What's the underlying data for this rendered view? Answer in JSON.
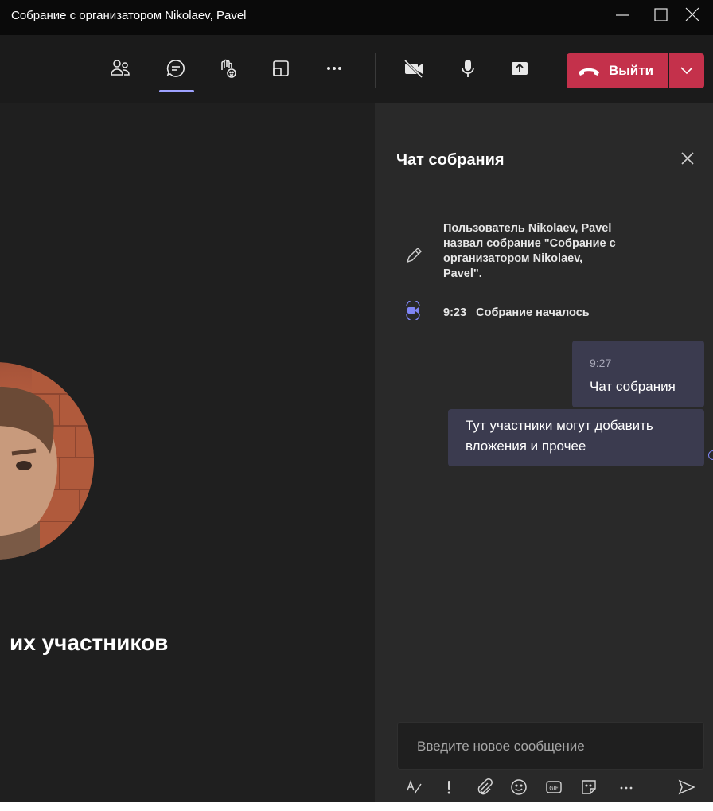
{
  "window": {
    "title": "Собрание с организатором Nikolaev, Pavel"
  },
  "toolbar": {
    "items": [
      {
        "name": "people-icon",
        "active": false
      },
      {
        "name": "chat-icon",
        "active": true
      },
      {
        "name": "reactions-icon",
        "active": false
      },
      {
        "name": "rooms-icon",
        "active": false
      },
      {
        "name": "more-icon",
        "active": false
      }
    ],
    "controls": [
      "camera-off-icon",
      "mic-icon",
      "share-icon"
    ],
    "leave_label": "Выйти",
    "accent_color": "#c4314b",
    "active_indicator_color": "#9ea2ff"
  },
  "stage": {
    "participants_text": "их участников"
  },
  "chat": {
    "title": "Чат собрания",
    "events": [
      {
        "icon": "pencil-icon",
        "lines": [
          "Пользователь Nikolaev, Pavel",
          "назвал собрание \"Собрание с",
          "организатором Nikolaev,",
          "Pavel\"."
        ]
      },
      {
        "icon": "meeting-started-icon",
        "time": "9:23",
        "text": "Собрание началось"
      }
    ],
    "messages": [
      {
        "time": "9:27",
        "text": "Чат собрания"
      },
      {
        "lines": [
          "Тут участники могут добавить",
          "вложения и прочее"
        ]
      }
    ],
    "input_placeholder": "Введите новое сообщение",
    "compose_tools": [
      "format-icon",
      "important-icon",
      "attach-icon",
      "emoji-icon",
      "gif-icon",
      "sticker-icon",
      "more-options-icon",
      "send-icon"
    ]
  }
}
